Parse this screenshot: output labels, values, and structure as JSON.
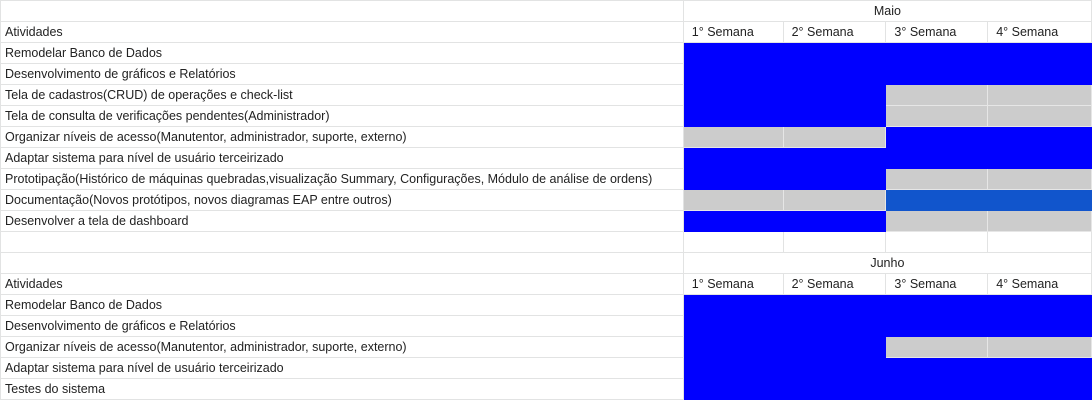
{
  "colors": {
    "blue": "#0000ff",
    "gray": "#cccccc",
    "light_blue": "#1155cc",
    "white": "#ffffff"
  },
  "sections": [
    {
      "month": "Maio",
      "header_label": "Atividades",
      "weeks": [
        "1° Semana",
        "2° Semana",
        "3° Semana",
        "4° Semana"
      ],
      "rows": [
        {
          "label": "Remodelar Banco de Dados",
          "cells": [
            "blue",
            "blue",
            "blue",
            "blue"
          ]
        },
        {
          "label": "Desenvolvimento de gráficos e Relatórios",
          "cells": [
            "blue",
            "blue",
            "blue",
            "blue"
          ]
        },
        {
          "label": "Tela de cadastros(CRUD) de operações e check-list",
          "cells": [
            "blue",
            "blue",
            "gray",
            "gray"
          ]
        },
        {
          "label": "Tela de consulta de verificações pendentes(Administrador)",
          "cells": [
            "blue",
            "blue",
            "gray",
            "gray"
          ]
        },
        {
          "label": "Organizar níveis de acesso(Manutentor, administrador, suporte, externo)",
          "cells": [
            "gray",
            "gray",
            "blue",
            "blue"
          ]
        },
        {
          "label": "Adaptar sistema para nível de usuário terceirizado",
          "cells": [
            "blue",
            "blue",
            "blue",
            "blue"
          ]
        },
        {
          "label": "Prototipação(Histórico de máquinas quebradas,visualização Summary, Configurações, Módulo de análise de ordens)",
          "cells": [
            "blue",
            "blue",
            "gray",
            "gray"
          ]
        },
        {
          "label": "Documentação(Novos protótipos, novos diagramas EAP entre outros)",
          "cells": [
            "gray",
            "gray",
            "light_blue",
            "light_blue"
          ]
        },
        {
          "label": "Desenvolver a tela de dashboard",
          "cells": [
            "blue",
            "blue",
            "gray",
            "gray"
          ]
        }
      ]
    },
    {
      "month": "Junho",
      "header_label": "Atividades",
      "weeks": [
        "1° Semana",
        "2° Semana",
        "3° Semana",
        "4° Semana"
      ],
      "rows": [
        {
          "label": "Remodelar Banco de Dados",
          "cells": [
            "blue",
            "blue",
            "blue",
            "blue"
          ]
        },
        {
          "label": "Desenvolvimento de gráficos e Relatórios",
          "cells": [
            "blue",
            "blue",
            "blue",
            "blue"
          ]
        },
        {
          "label": "Organizar níveis de acesso(Manutentor, administrador, suporte, externo)",
          "cells": [
            "blue",
            "blue",
            "gray",
            "gray"
          ]
        },
        {
          "label": "Adaptar sistema para nível de usuário terceirizado",
          "cells": [
            "blue",
            "blue",
            "blue",
            "blue"
          ]
        },
        {
          "label": "Testes do sistema",
          "cells": [
            "blue",
            "blue",
            "blue",
            "blue"
          ]
        }
      ]
    }
  ]
}
